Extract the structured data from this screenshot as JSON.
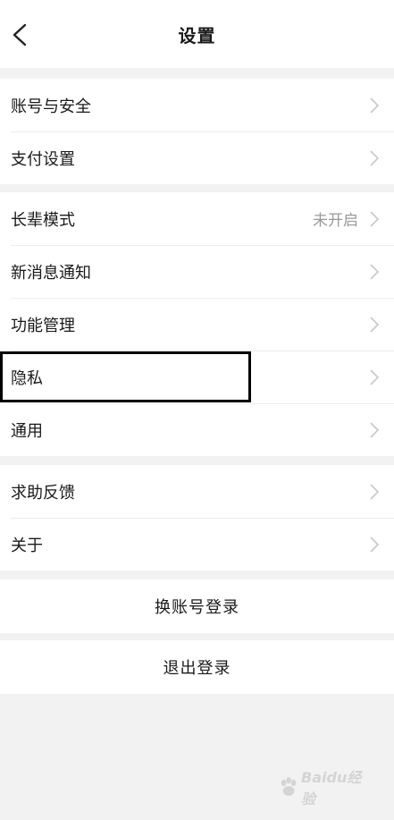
{
  "header": {
    "title": "设置"
  },
  "groups": [
    {
      "items": [
        {
          "label": "账号与安全"
        },
        {
          "label": "支付设置"
        }
      ]
    },
    {
      "items": [
        {
          "label": "长辈模式",
          "value": "未开启"
        },
        {
          "label": "新消息通知"
        },
        {
          "label": "功能管理"
        },
        {
          "label": "隐私"
        },
        {
          "label": "通用"
        }
      ]
    },
    {
      "items": [
        {
          "label": "求助反馈"
        },
        {
          "label": "关于"
        }
      ]
    }
  ],
  "actions": {
    "switch_account": "换账号登录",
    "logout": "退出登录"
  },
  "watermark": {
    "text": "Baidu经验"
  },
  "colors": {
    "background": "#f2f2f2",
    "card": "#ffffff",
    "secondary_text": "#999999",
    "chevron": "#c8c8c8",
    "highlight_border": "#000000"
  }
}
